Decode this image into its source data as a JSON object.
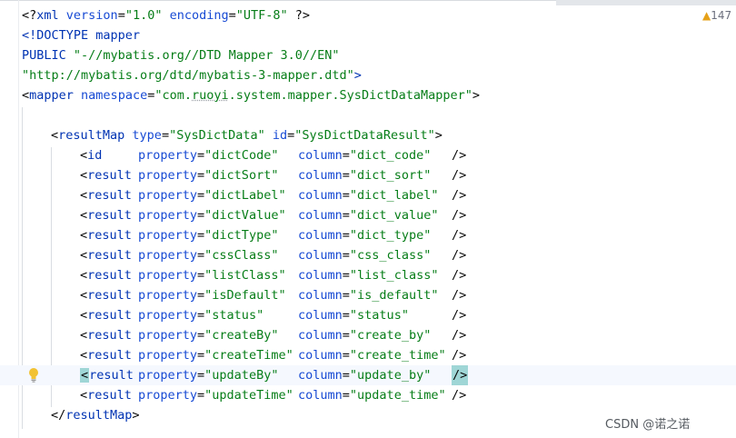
{
  "editor": {
    "inspection_count": "147",
    "watermark": "CSDN @诺之诺",
    "lines": [
      "<?xml version=\"1.0\" encoding=\"UTF-8\" ?>",
      "<!DOCTYPE mapper",
      "PUBLIC \"-//mybatis.org//DTD Mapper 3.0//EN\"",
      "\"http://mybatis.org/dtd/mybatis-3-mapper.dtd\">",
      "<mapper namespace=\"com.ruoyi.system.mapper.SysDictDataMapper\">",
      "",
      "<resultMap type=\"SysDictData\" id=\"SysDictDataResult\">"
    ],
    "xml_decl": {
      "open": "<?",
      "name": "xml",
      "version_attr": " version",
      "version_eq": "=",
      "version_val": "\"1.0\"",
      "encoding_attr": " encoding",
      "encoding_eq": "=",
      "encoding_val": "\"UTF-8\"",
      "close": " ?>"
    },
    "doctype": {
      "line1_open": "<!",
      "line1_name": "DOCTYPE mapper",
      "line2_public": "PUBLIC ",
      "line2_val": "\"-//mybatis.org//DTD Mapper 3.0//EN\"",
      "line3_val": "\"http://mybatis.org/dtd/mybatis-3-mapper.dtd\"",
      "line3_close": ">"
    },
    "mapper_tag": {
      "open": "<",
      "name": "mapper",
      "attr": " namespace",
      "eq": "=",
      "val_q1": "\"",
      "val_pre": "com.",
      "val_under": "ruoyi",
      "val_post": ".system.mapper.SysDictDataMapper",
      "val_q2": "\"",
      "close": ">"
    },
    "resultmap_open": {
      "open": "<",
      "name": "resultMap",
      "type_attr": " type",
      "type_eq": "=",
      "type_val": "\"SysDictData\"",
      "id_attr": " id",
      "id_eq": "=",
      "id_val": "\"SysDictDataResult\"",
      "close": ">"
    },
    "result_rows": [
      {
        "tag": "id",
        "property": "\"dictCode\"",
        "column": "\"dict_code\""
      },
      {
        "tag": "result",
        "property": "\"dictSort\"",
        "column": "\"dict_sort\""
      },
      {
        "tag": "result",
        "property": "\"dictLabel\"",
        "column": "\"dict_label\""
      },
      {
        "tag": "result",
        "property": "\"dictValue\"",
        "column": "\"dict_value\""
      },
      {
        "tag": "result",
        "property": "\"dictType\"",
        "column": "\"dict_type\""
      },
      {
        "tag": "result",
        "property": "\"cssClass\"",
        "column": "\"css_class\""
      },
      {
        "tag": "result",
        "property": "\"listClass\"",
        "column": "\"list_class\""
      },
      {
        "tag": "result",
        "property": "\"isDefault\"",
        "column": "\"is_default\""
      },
      {
        "tag": "result",
        "property": "\"status\"",
        "column": "\"status\""
      },
      {
        "tag": "result",
        "property": "\"createBy\"",
        "column": "\"create_by\""
      },
      {
        "tag": "result",
        "property": "\"createTime\"",
        "column": "\"create_time\""
      },
      {
        "tag": "result",
        "property": "\"updateBy\"",
        "column": "\"update_by\""
      },
      {
        "tag": "result",
        "property": "\"updateTime\"",
        "column": "\"update_time\""
      }
    ],
    "row_parts": {
      "lt": "<",
      "property_attr": "property",
      "column_attr": "column",
      "eq": "=",
      "self_close": "/>"
    },
    "resultmap_close": {
      "open": "</",
      "name": "resultMap",
      "close": ">"
    }
  },
  "colors": {
    "tag": "#0033b3",
    "attribute": "#174ad4",
    "string": "#067d17",
    "current_line": "#f5f8fe",
    "bracket_highlight": "#9fd6d6",
    "warning": "#e6a118"
  },
  "icons": {
    "warning": "warning-triangle-icon",
    "intention": "lightbulb-icon"
  }
}
